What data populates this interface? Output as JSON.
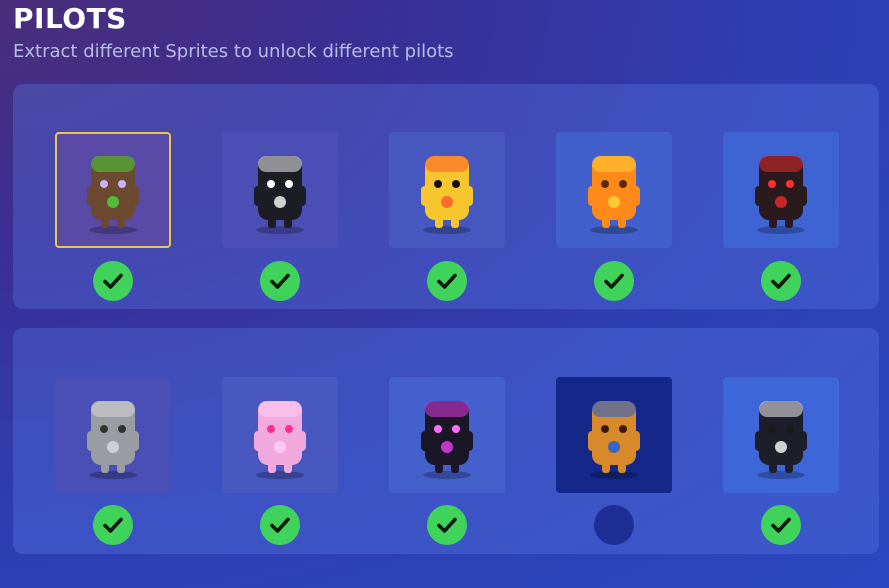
{
  "header": {
    "title": "PILOTS",
    "subtitle": "Extract different Sprites to unlock different pilots"
  },
  "rows": [
    [
      {
        "name": "wood-sprite",
        "unlocked": true,
        "selected": true,
        "card_bg": "#5a4aa8",
        "body": "#6b4a30",
        "accent": "#4ccf3a",
        "eyes": "#c9b3ff"
      },
      {
        "name": "punk-sprite",
        "unlocked": true,
        "selected": false,
        "card_bg": "#4b4fb5",
        "body": "#1c1c24",
        "accent": "#f0f0f0",
        "eyes": "#ffffff"
      },
      {
        "name": "duck-sprite",
        "unlocked": true,
        "selected": false,
        "card_bg": "#4658c0",
        "body": "#f7c62e",
        "accent": "#ff5a2a",
        "eyes": "#111111"
      },
      {
        "name": "fire-sprite",
        "unlocked": true,
        "selected": false,
        "card_bg": "#4260cc",
        "body": "#ff8a1a",
        "accent": "#ffd23a",
        "eyes": "#5a2a00"
      },
      {
        "name": "demon-sprite",
        "unlocked": true,
        "selected": false,
        "card_bg": "#3e64d4",
        "body": "#2a1a1e",
        "accent": "#e02a2a",
        "eyes": "#ff3030"
      }
    ],
    [
      {
        "name": "stone-sprite",
        "unlocked": true,
        "selected": false,
        "card_bg": "#4a4fb5",
        "body": "#9a9ca4",
        "accent": "#d8d8dc",
        "eyes": "#333333"
      },
      {
        "name": "ghost-sprite",
        "unlocked": true,
        "selected": false,
        "card_bg": "#4858c0",
        "body": "#f2a9de",
        "accent": "#ffd0f2",
        "eyes": "#ff2f8a"
      },
      {
        "name": "void-sprite",
        "unlocked": true,
        "selected": false,
        "card_bg": "#4460cc",
        "body": "#1a1626",
        "accent": "#e23ae6",
        "eyes": "#ff6cff"
      },
      {
        "name": "peanut-sprite",
        "unlocked": false,
        "selected": false,
        "card_bg": "#15288a",
        "body": "#d88a2a",
        "accent": "#1e5ed8",
        "eyes": "#3a1a00"
      },
      {
        "name": "skull-sprite",
        "unlocked": true,
        "selected": false,
        "card_bg": "#3d67d8",
        "body": "#1e1e2a",
        "accent": "#f0f0f0",
        "eyes": "#1a1a1a"
      }
    ]
  ],
  "colors": {
    "check_on": "#3fd35c",
    "check_off": "#1d2f95",
    "select_border": "#e8c84a"
  }
}
